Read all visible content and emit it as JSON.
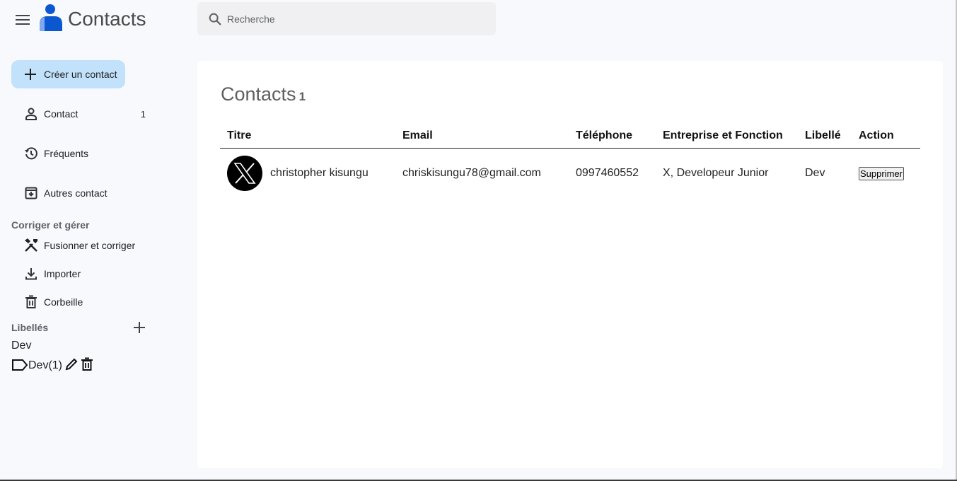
{
  "header": {
    "app_title": "Contacts",
    "search_placeholder": "Recherche"
  },
  "sidebar": {
    "create_label": "Créer un contact",
    "nav": [
      {
        "label": "Contact",
        "count": "1",
        "icon": "person-icon"
      },
      {
        "label": "Fréquents",
        "count": "",
        "icon": "history-icon"
      },
      {
        "label": "Autres contact",
        "count": "",
        "icon": "archive-download-icon"
      }
    ],
    "manage_title": "Corriger et gérer",
    "manage": [
      {
        "label": "Fusionner et corriger",
        "icon": "tools-icon"
      },
      {
        "label": "Importer",
        "icon": "download-icon"
      },
      {
        "label": "Corbeille",
        "icon": "trash-icon"
      }
    ],
    "labels_title": "Libellés",
    "label_name": "Dev",
    "label_item": "Dev(1)"
  },
  "main": {
    "title": "Contacts",
    "count": "1",
    "columns": [
      "Titre",
      "Email",
      "Téléphone",
      "Entreprise et Fonction",
      "Libellé",
      "Action"
    ],
    "rows": [
      {
        "name": "christopher kisungu",
        "email": "chriskisungu78@gmail.com",
        "phone": "0997460552",
        "company": "X, Developeur Junior",
        "label": "Dev",
        "action": "Supprimer"
      }
    ]
  },
  "colors": {
    "accent": "#c2e1fb",
    "logo_blue": "#0b57d0",
    "background": "#f8f9fd"
  }
}
